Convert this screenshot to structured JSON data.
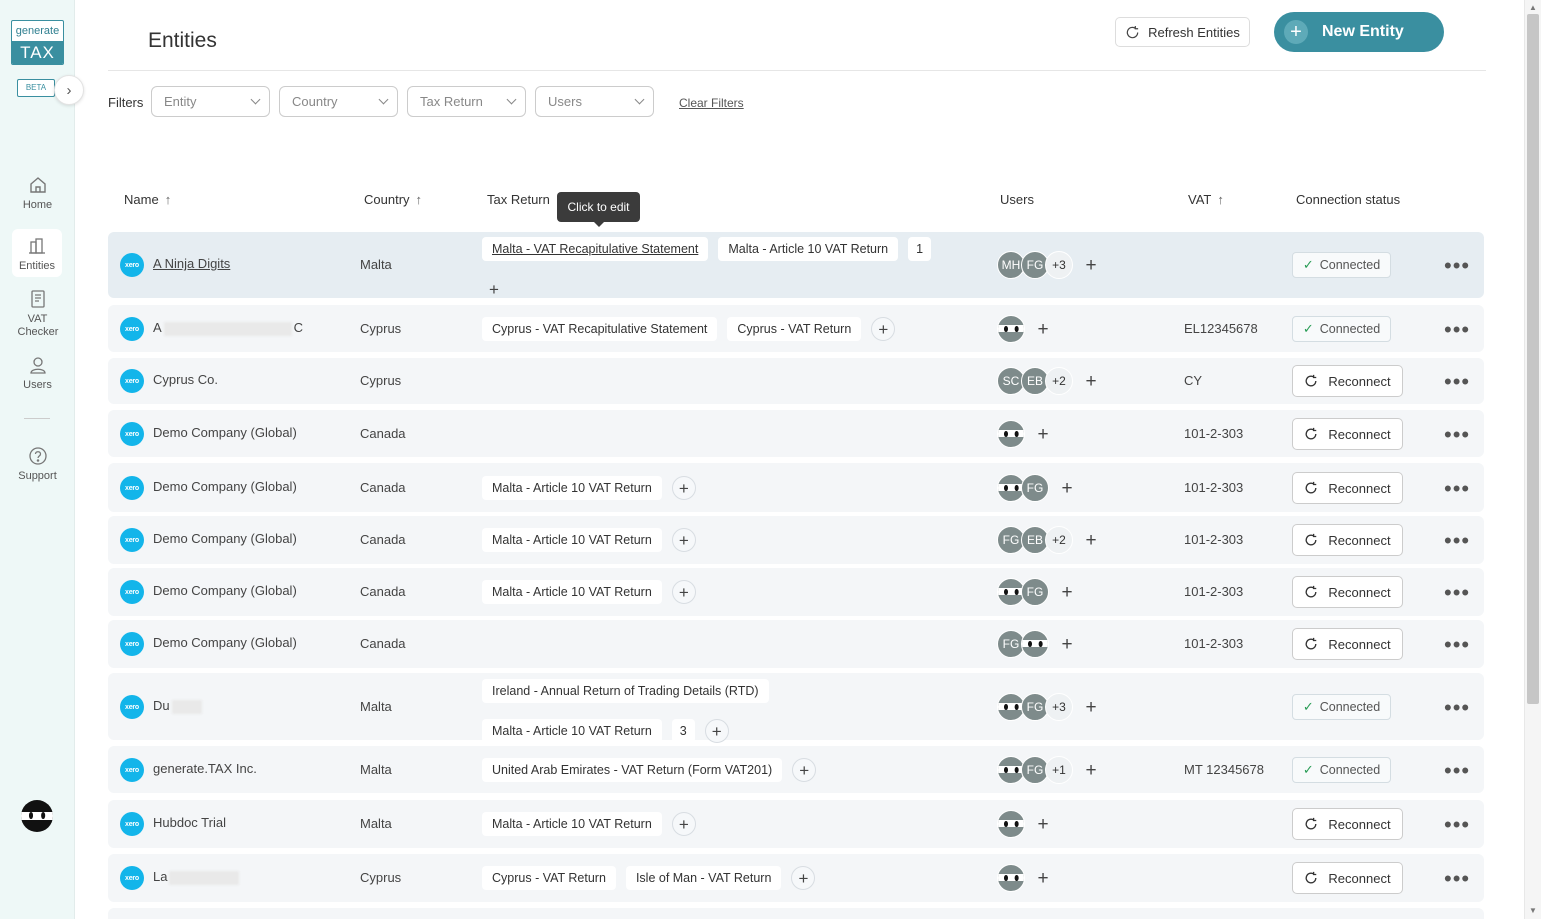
{
  "sidebar": {
    "logo_top": "generate",
    "logo_bottom": "TAX",
    "beta": "BETA",
    "items": [
      {
        "label": "Home"
      },
      {
        "label": "Entities"
      },
      {
        "label": "VAT Checker"
      },
      {
        "label": "Users"
      },
      {
        "label": "Support"
      }
    ]
  },
  "header": {
    "title": "Entities",
    "refresh_label": "Refresh Entities",
    "new_entity_label": "New Entity"
  },
  "filters": {
    "label": "Filters",
    "entity": "Entity",
    "country": "Country",
    "tax_return": "Tax Return",
    "users": "Users",
    "clear": "Clear Filters"
  },
  "table": {
    "columns": {
      "name": "Name",
      "country": "Country",
      "tax_return": "Tax Return",
      "users": "Users",
      "vat": "VAT",
      "connection": "Connection status"
    },
    "tooltip": "Click to edit",
    "xero_label": "xero",
    "rows": [
      {
        "name": "A Ninja Digits",
        "country": "Malta",
        "tax_returns": [
          "Malta - VAT Recapitulative Statement",
          "Malta - Article 10 VAT Return"
        ],
        "more": "1",
        "users": [
          "MH",
          "FG"
        ],
        "users_more": "+3",
        "vat": "",
        "status": "Connected"
      },
      {
        "name_start": "A",
        "name_end": "C",
        "country": "Cyprus",
        "tax_returns": [
          "Cyprus - VAT Recapitulative Statement",
          "Cyprus - VAT Return"
        ],
        "vat": "EL12345678",
        "status": "Connected"
      },
      {
        "name": "Cyprus Co.",
        "country": "Cyprus",
        "users": [
          "SC",
          "EB"
        ],
        "users_more": "+2",
        "vat": "CY",
        "status": "Reconnect"
      },
      {
        "name": "Demo Company (Global)",
        "country": "Canada",
        "vat": "101-2-303",
        "status": "Reconnect"
      },
      {
        "name": "Demo Company (Global)",
        "country": "Canada",
        "tax_returns": [
          "Malta - Article 10 VAT Return"
        ],
        "users": [
          "FG"
        ],
        "vat": "101-2-303",
        "status": "Reconnect"
      },
      {
        "name": "Demo Company (Global)",
        "country": "Canada",
        "tax_returns": [
          "Malta - Article 10 VAT Return"
        ],
        "users": [
          "FG",
          "EB"
        ],
        "users_more": "+2",
        "vat": "101-2-303",
        "status": "Reconnect"
      },
      {
        "name": "Demo Company (Global)",
        "country": "Canada",
        "tax_returns": [
          "Malta - Article 10 VAT Return"
        ],
        "users": [
          "FG"
        ],
        "vat": "101-2-303",
        "status": "Reconnect"
      },
      {
        "name": "Demo Company (Global)",
        "country": "Canada",
        "users": [
          "FG"
        ],
        "vat": "101-2-303",
        "status": "Reconnect"
      },
      {
        "name_start": "Du",
        "country": "Malta",
        "tax_returns": [
          "Ireland - Annual Return of Trading Details (RTD)",
          "Malta - Article 10 VAT Return"
        ],
        "more": "3",
        "users": [
          "FG"
        ],
        "users_more": "+3",
        "vat": "",
        "status": "Connected"
      },
      {
        "name": "generate.TAX Inc.",
        "country": "Malta",
        "tax_returns": [
          "United Arab Emirates - VAT Return (Form VAT201)"
        ],
        "users": [
          "FG"
        ],
        "users_more": "+1",
        "vat": "MT 12345678",
        "status": "Connected"
      },
      {
        "name": "Hubdoc Trial",
        "country": "Malta",
        "tax_returns": [
          "Malta - Article 10 VAT Return"
        ],
        "vat": "",
        "status": "Reconnect"
      },
      {
        "name_start": "La",
        "country": "Cyprus",
        "tax_returns": [
          "Cyprus - VAT Return",
          "Isle of Man - VAT Return"
        ],
        "vat": "",
        "status": "Reconnect"
      }
    ]
  },
  "icons": {
    "home": "home-icon",
    "entities": "building-icon",
    "vat_checker": "document-icon",
    "users": "user-icon",
    "support": "question-icon",
    "refresh": "refresh-icon",
    "check": "check-icon",
    "more": "more-horizontal-icon"
  },
  "colors": {
    "accent": "#3a8fa0",
    "xero": "#13b5ea",
    "connected": "#2a9d56",
    "sidebar_bg": "#eef8f7"
  }
}
